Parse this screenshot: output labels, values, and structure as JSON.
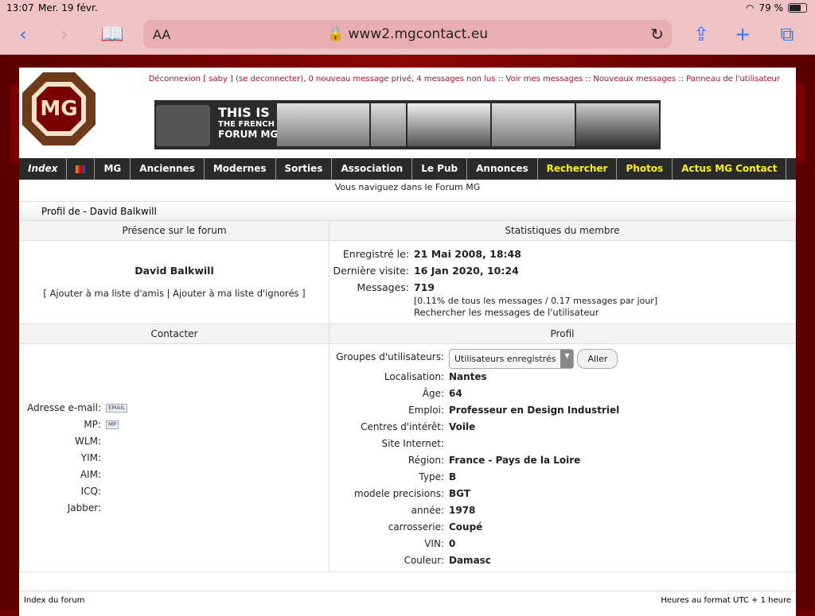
{
  "statusbar": {
    "time": "13:07",
    "date": "Mer. 19 févr.",
    "battery": "79 %",
    "battery_level": 0.79
  },
  "browser": {
    "aa": "AA",
    "url": "www2.mgcontact.eu"
  },
  "top_links": "Déconnexion [ saby ] (se deconnecter), 0 nouveau message privé, 4 messages non lus :: Voir mes messages :: Nouveaux messages :: Panneau de l'utilisateur",
  "banner": {
    "line1": "THIS IS",
    "line2": "THE FRENCH",
    "line3": "FORUM MG"
  },
  "nav": [
    {
      "label": "Index",
      "style": "italic"
    },
    {
      "label": "",
      "style": "flag"
    },
    {
      "label": "MG",
      "style": ""
    },
    {
      "label": "Anciennes",
      "style": ""
    },
    {
      "label": "Modernes",
      "style": ""
    },
    {
      "label": "Sorties",
      "style": ""
    },
    {
      "label": "Association",
      "style": ""
    },
    {
      "label": "Le Pub",
      "style": ""
    },
    {
      "label": "Annonces",
      "style": ""
    },
    {
      "label": "Rechercher",
      "style": "yellow"
    },
    {
      "label": "Photos",
      "style": "yellow"
    },
    {
      "label": "Actus MG Contact",
      "style": "yellow"
    }
  ],
  "breadcrumb": "Vous naviguez dans le Forum MG",
  "profile_title": "Profil de - David Balkwill",
  "sections": {
    "presence": "Présence sur le forum",
    "stats": "Statistiques du membre",
    "contact": "Contacter",
    "profile": "Profil"
  },
  "member": {
    "name": "David Balkwill",
    "friends": "[ Ajouter à ma liste d'amis | Ajouter à ma liste d'ignorés ]"
  },
  "stats": {
    "registered_label": "Enregistré le:",
    "registered": "21 Mai 2008, 18:48",
    "last_visit_label": "Dernière visite:",
    "last_visit": "16 Jan 2020, 10:24",
    "messages_label": "Messages:",
    "messages": "719",
    "messages_detail": "[0.11% de tous les messages / 0.17 messages par jour]",
    "search_link": "Rechercher les messages de l'utilisateur"
  },
  "contact": [
    {
      "label": "Adresse e-mail:",
      "badge": "EMAIL"
    },
    {
      "label": "MP:",
      "badge": "MP"
    },
    {
      "label": "WLM:",
      "badge": ""
    },
    {
      "label": "YIM:",
      "badge": ""
    },
    {
      "label": "AIM:",
      "badge": ""
    },
    {
      "label": "ICQ:",
      "badge": ""
    },
    {
      "label": "Jabber:",
      "badge": ""
    }
  ],
  "profile": {
    "groups_label": "Groupes d'utilisateurs:",
    "groups_value": "Utilisateurs enregistrés",
    "go": "Aller",
    "fields": [
      {
        "k": "Localisation:",
        "v": "Nantes"
      },
      {
        "k": "Âge:",
        "v": "64"
      },
      {
        "k": "Emploi:",
        "v": "Professeur en Design Industriel"
      },
      {
        "k": "Centres d'intérêt:",
        "v": "Voile"
      },
      {
        "k": "Site Internet:",
        "v": ""
      },
      {
        "k": "Région:",
        "v": "France - Pays de la Loire"
      },
      {
        "k": "Type:",
        "v": "B"
      },
      {
        "k": "modele precisions:",
        "v": "BGT"
      },
      {
        "k": "année:",
        "v": "1978"
      },
      {
        "k": "carrosserie:",
        "v": "Coupé"
      },
      {
        "k": "VIN:",
        "v": "0"
      },
      {
        "k": "Couleur:",
        "v": "Damasc"
      }
    ]
  },
  "footer": {
    "left": "Index du forum",
    "right": "Heures au format UTC + 1 heure"
  }
}
